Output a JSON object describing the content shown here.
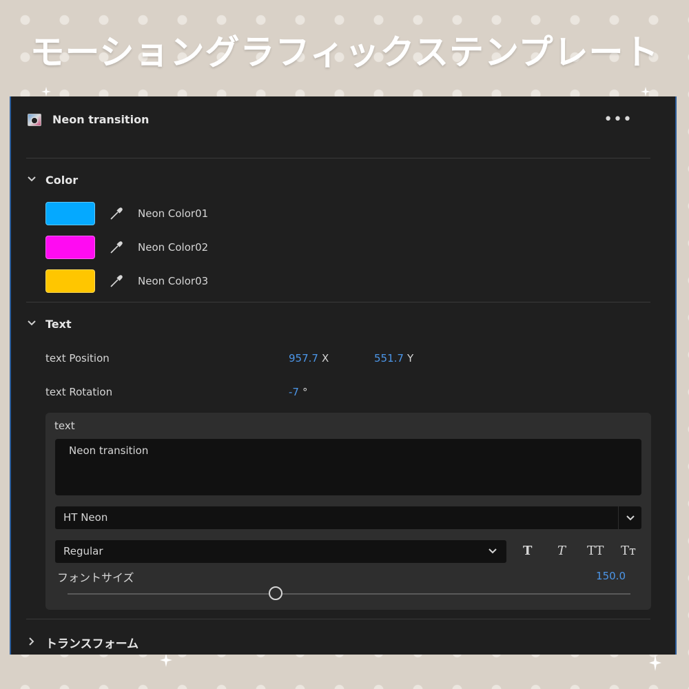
{
  "banner": {
    "title": "モーショングラフィックステンプレート"
  },
  "panel": {
    "title": "Neon transition",
    "more_icon": "more-icon"
  },
  "color_section": {
    "label": "Color",
    "swatches": [
      {
        "label": "Neon Color01",
        "color": "#05a9ff"
      },
      {
        "label": "Neon Color02",
        "color": "#ff0bf2"
      },
      {
        "label": "Neon Color03",
        "color": "#ffc600"
      }
    ]
  },
  "text_section": {
    "label": "Text",
    "position": {
      "label": "text Position",
      "x": "957.7",
      "x_unit": "X",
      "y": "551.7",
      "y_unit": "Y"
    },
    "rotation": {
      "label": "text Rotation",
      "value": "-7",
      "unit": "°"
    },
    "text_group": {
      "label": "text",
      "content": "Neon transition",
      "font": "HT Neon",
      "style": "Regular",
      "format_buttons": [
        "T",
        "T",
        "TT",
        "Tт"
      ],
      "font_size_label": "フォントサイズ",
      "font_size": "150.0",
      "slider_level": 0.37
    }
  },
  "transform_section": {
    "label": "トランスフォーム"
  },
  "accent_color": "#4c96e8"
}
